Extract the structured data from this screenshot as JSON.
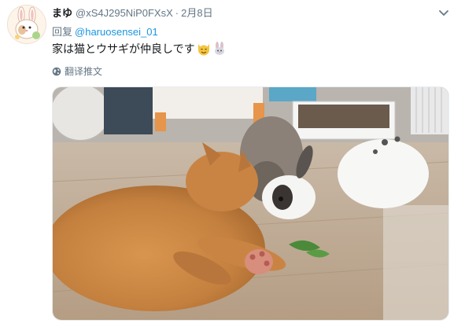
{
  "tweet": {
    "display_name": "まゆ",
    "handle": "@xS4J295NiP0FXsX",
    "separator": "·",
    "date": "2月8日",
    "reply_prefix": "回复",
    "reply_to": "@haruosensei_01",
    "text": "家は猫とウサギが仲良しです",
    "emojis": [
      "cat-face-emoji",
      "rabbit-emoji"
    ],
    "translate_label": "翻译推文"
  },
  "icons": {
    "avatar": "rabbit-avatar-icon",
    "menu": "chevron-down-icon",
    "translate": "globe-icon"
  },
  "colors": {
    "link": "#1b95e0",
    "secondary_text": "#657786",
    "primary_text": "#14171a"
  }
}
